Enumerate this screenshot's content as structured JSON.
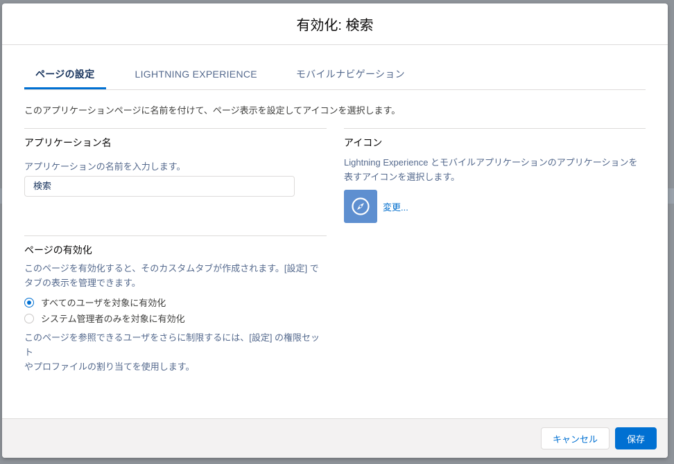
{
  "modal": {
    "title": "有効化: 検索"
  },
  "tabs": [
    {
      "label": "ページの設定",
      "active": true
    },
    {
      "label": "LIGHTNING EXPERIENCE",
      "active": false
    },
    {
      "label": "モバイルナビゲーション",
      "active": false
    }
  ],
  "intro": "このアプリケーションページに名前を付けて、ページ表示を設定してアイコンを選択します。",
  "app_name": {
    "title": "アプリケーション名",
    "help": "アプリケーションの名前を入力します。",
    "value": "検索"
  },
  "activation": {
    "title": "ページの有効化",
    "description_line1": "このページを有効化すると、そのカスタムタブが作成されます。[設定] で",
    "description_line2": "タブの表示を管理できます。",
    "options": [
      {
        "label": "すべてのユーザを対象に有効化",
        "checked": true
      },
      {
        "label": "システム管理者のみを対象に有効化",
        "checked": false
      }
    ],
    "note_line1": "このページを参照できるユーザをさらに制限するには、[設定] の権限セット",
    "note_line2": "やプロファイルの割り当てを使用します。"
  },
  "icon_section": {
    "title": "アイコン",
    "description_line1": "Lightning Experience とモバイルアプリケーションのアプリケーションを",
    "description_line2": "表すアイコンを選択します。",
    "icon_name": "compass-icon",
    "icon_color": "#5e8fd0",
    "change_label": "変更..."
  },
  "footer": {
    "cancel_label": "キャンセル",
    "save_label": "保存"
  },
  "colors": {
    "accent": "#0070d2",
    "tab_text": "#54698d"
  }
}
